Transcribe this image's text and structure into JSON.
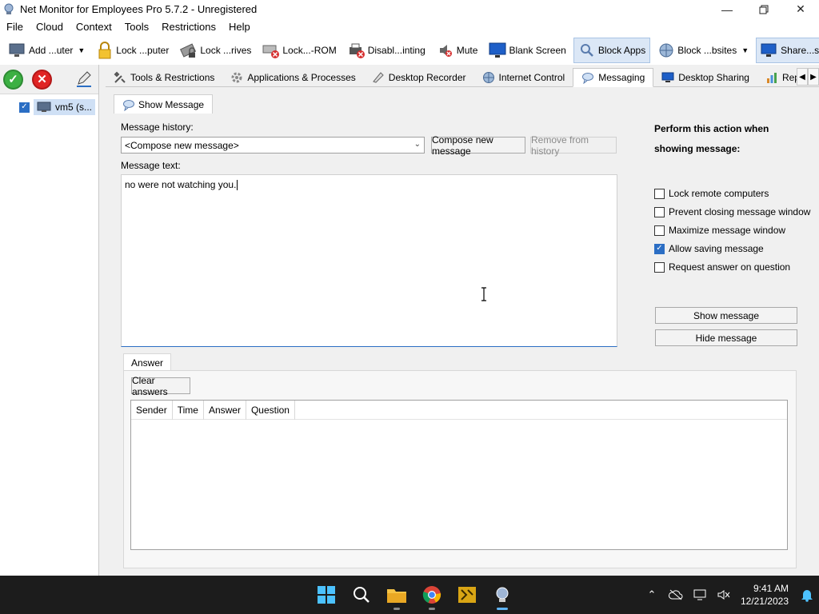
{
  "window": {
    "title": "Net Monitor for Employees Pro 5.7.2 - Unregistered",
    "controls": [
      "minimize-icon",
      "restore-icon",
      "close-icon"
    ]
  },
  "menu": [
    "File",
    "Cloud",
    "Context",
    "Tools",
    "Restrictions",
    "Help"
  ],
  "toolbar": {
    "add_computer": "Add ...uter",
    "lock_computer": "Lock ...puter",
    "lock_drives": "Lock ...rives",
    "lock_cdrom": "Lock...-ROM",
    "disable_printing": "Disabl...inting",
    "mute": "Mute",
    "blank_screen": "Blank Screen",
    "block_apps": "Block Apps",
    "block_websites": "Block ...bsites",
    "share_desktop": "Share...sktop"
  },
  "tree": {
    "computer_label": "vm5 (s...",
    "computer_checked": true
  },
  "tabs": {
    "tools": "Tools & Restrictions",
    "apps": "Applications & Processes",
    "recorder": "Desktop Recorder",
    "internet": "Internet Control",
    "messaging": "Messaging",
    "sharing": "Desktop Sharing",
    "reporting": "Reporting"
  },
  "messaging": {
    "subtab": "Show Message",
    "history_label": "Message history:",
    "history_value": "<Compose new message>",
    "compose_button": "Compose new message",
    "remove_button": "Remove from history",
    "text_label": "Message text:",
    "text_value": "no were not watching you.",
    "action_title": "Perform this action when showing message:",
    "options": {
      "lock": "Lock remote computers",
      "prevent_close": "Prevent closing message window",
      "maximize": "Maximize message window",
      "allow_saving": "Allow saving message",
      "request_answer": "Request answer on question"
    },
    "options_checked": {
      "lock": false,
      "prevent_close": false,
      "maximize": false,
      "allow_saving": true,
      "request_answer": false
    },
    "show_button": "Show message",
    "hide_button": "Hide message",
    "answer_tab": "Answer",
    "clear_button": "Clear answers",
    "columns": [
      "Sender",
      "Time",
      "Answer",
      "Question"
    ]
  },
  "taskbar": {
    "time": "9:41 AM",
    "date": "12/21/2023"
  },
  "colors": {
    "accent": "#2b6ec4",
    "taskbar": "#1c1c1c"
  }
}
